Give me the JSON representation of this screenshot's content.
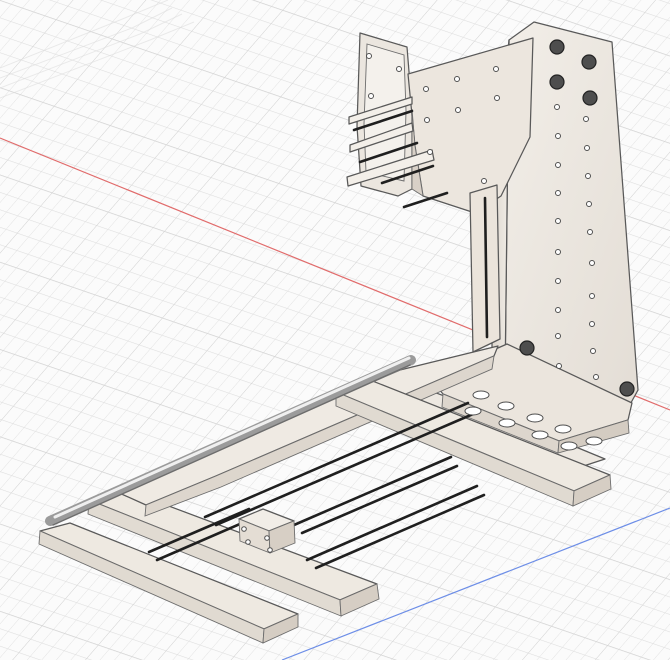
{
  "viewport": {
    "background": "#fbfbfb",
    "grid_color": "#d8d8d8",
    "grid_bold_color": "#cfcfcf",
    "red_axis_color": "#e16b6b",
    "blue_axis_color": "#6d8ee7",
    "model_face_light": "#f0ece6",
    "model_face_mid": "#e7e1d9",
    "model_face_dark": "#d9d2c8",
    "model_edge": "#595959",
    "model_slot": "#1f1f1f"
  },
  "icons": {
    "bolt": "bolt-icon",
    "hole": "hole-icon"
  }
}
